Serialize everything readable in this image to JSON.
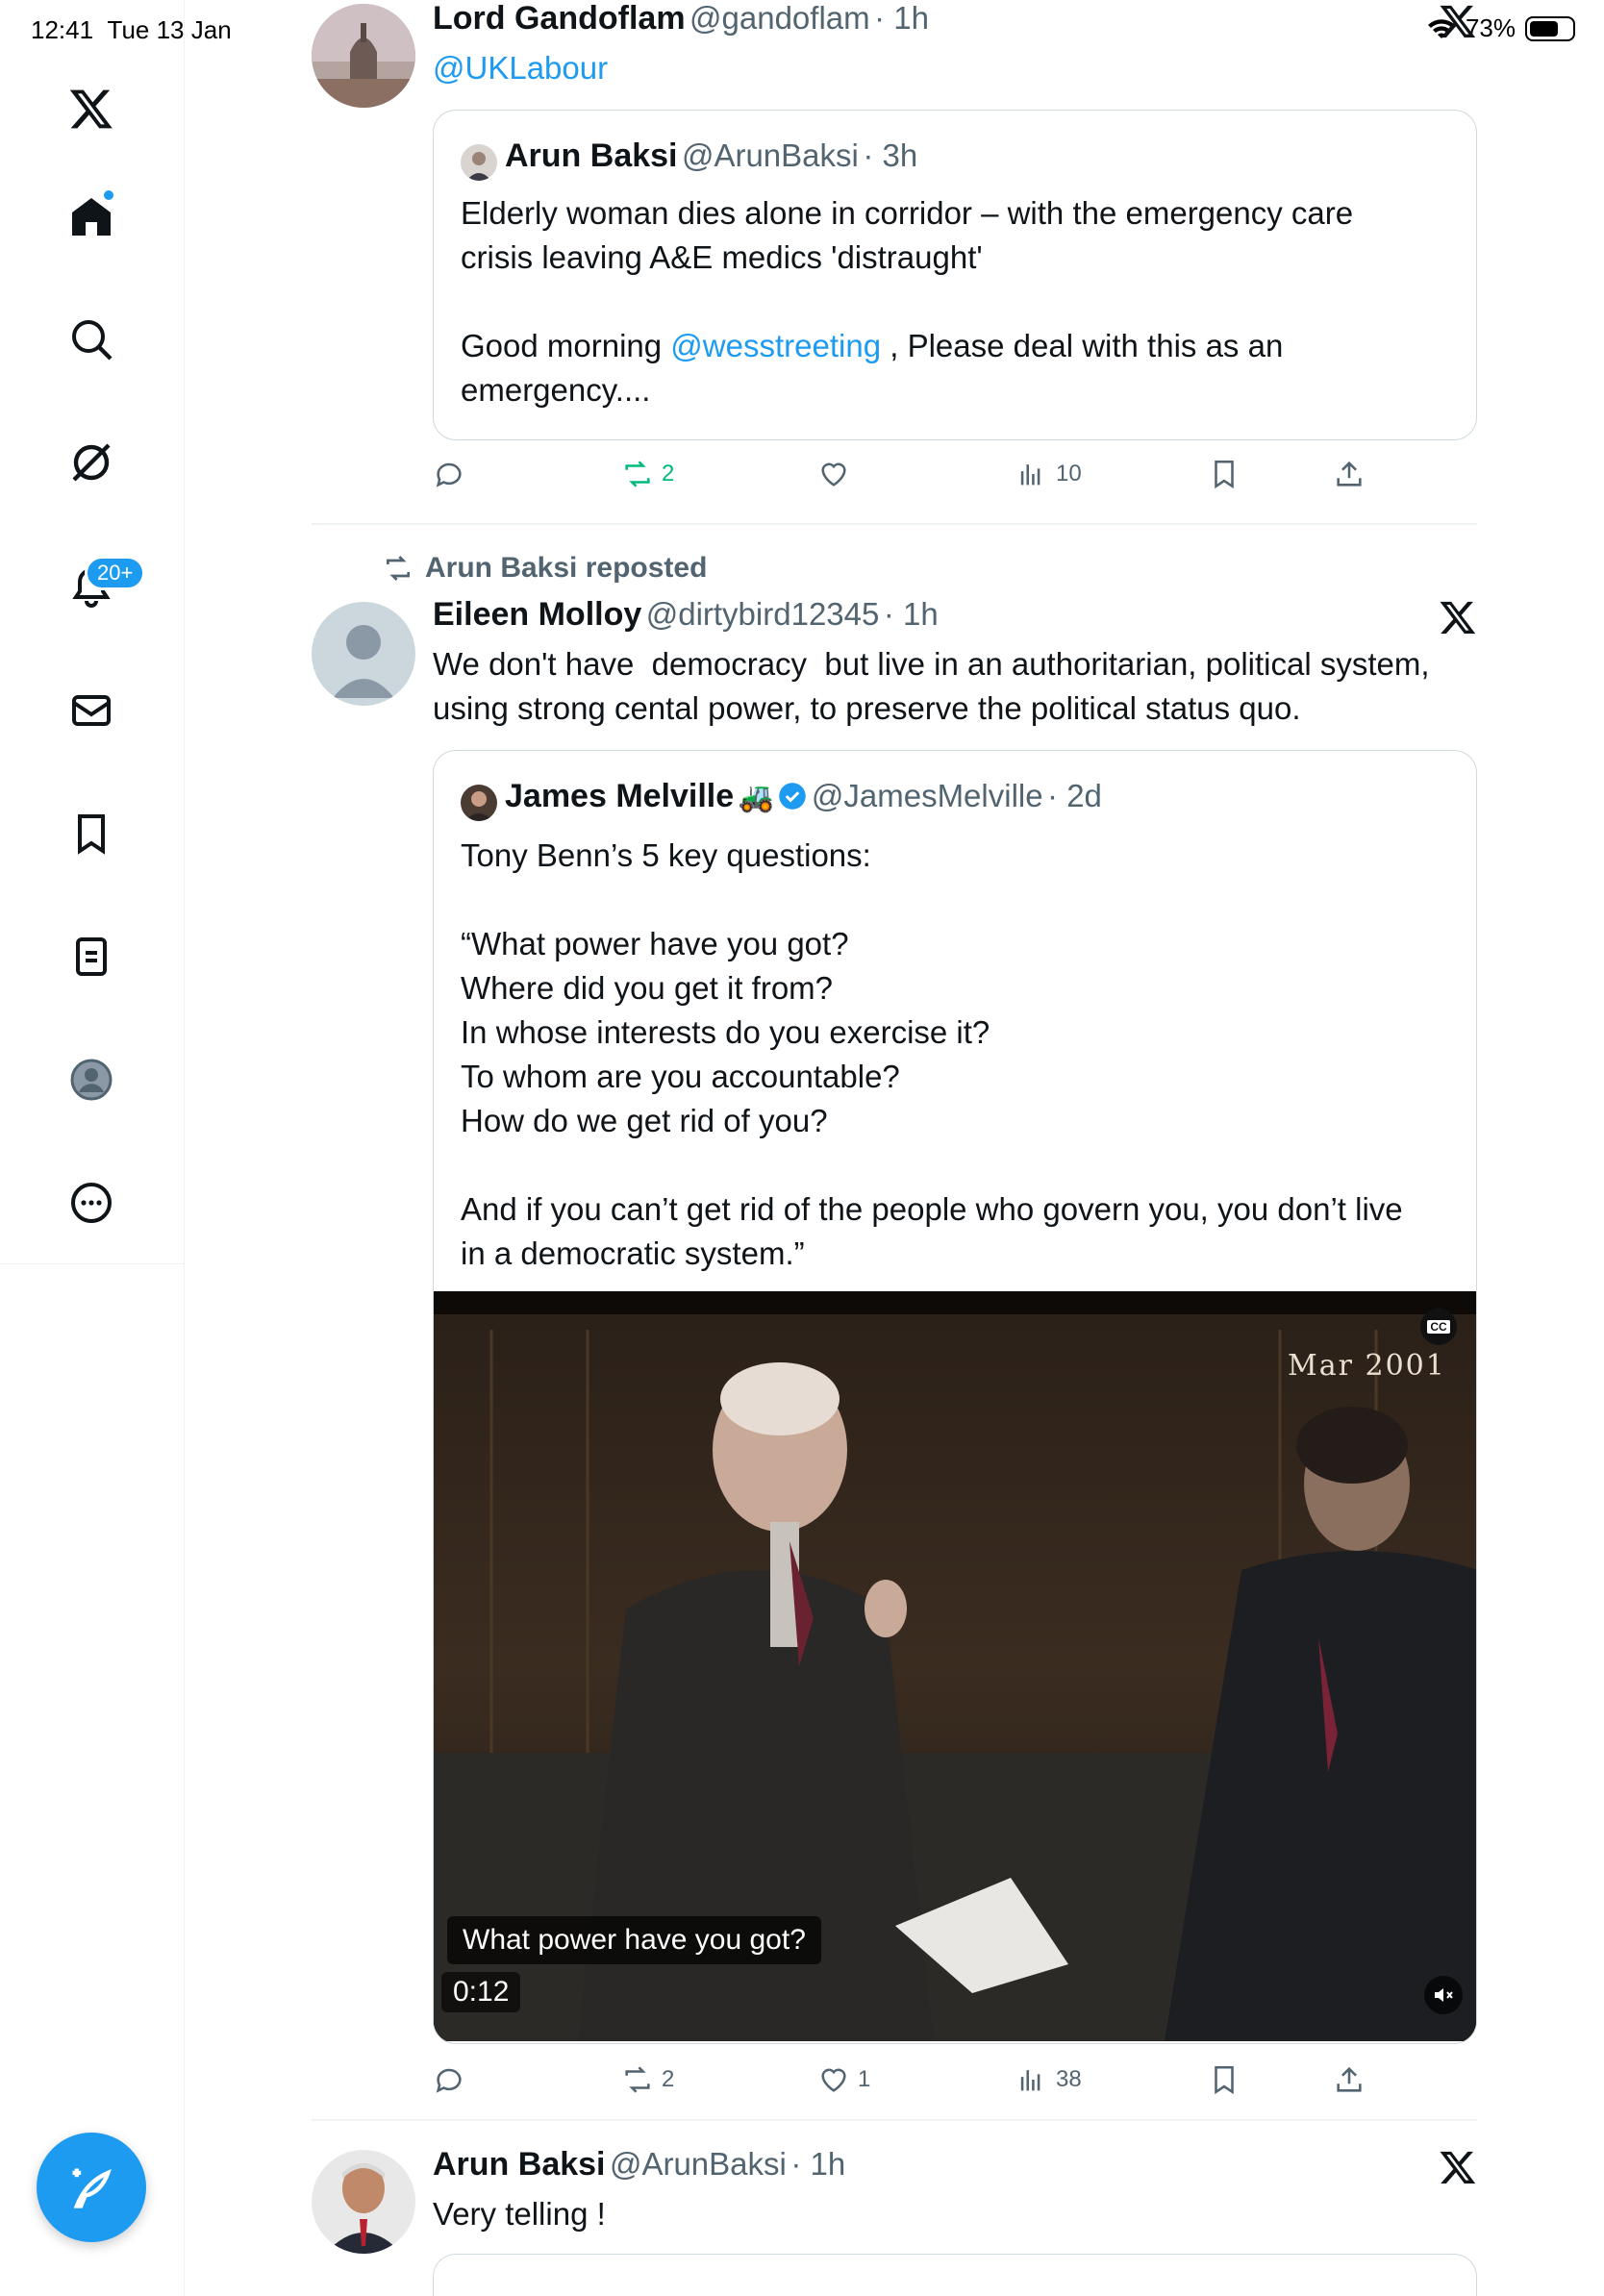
{
  "status_bar": {
    "time": "12:41",
    "date": "Tue 13 Jan",
    "battery": "73%"
  },
  "sidebar": {
    "notifications_badge": "20+",
    "icons": [
      "x-logo-icon",
      "home-icon",
      "search-icon",
      "grok-icon",
      "bell-icon",
      "mail-icon",
      "bookmark-icon",
      "lists-icon",
      "profile-icon",
      "more-icon"
    ]
  },
  "posts": [
    {
      "name": "Lord Gandoflam",
      "handle": "@gandoflam",
      "time": "· 1h",
      "reply_to": "@UKLabour",
      "quote": {
        "name": "Arun Baksi",
        "handle": "@ArunBaksi",
        "time": "· 3h",
        "line1": "Elderly woman dies alone in corridor – with the emergency care",
        "line2": "crisis leaving A&E medics 'distraught'",
        "line3_prefix": "Good morning ",
        "line3_mention": "@wesstreeting",
        "line3_suffix": " , Please deal with this as an",
        "line4": "emergency...."
      },
      "actions": {
        "reposts": "2",
        "views": "10"
      }
    },
    {
      "repost_label": "Arun Baksi reposted",
      "name": "Eileen Molloy",
      "handle": "@dirtybird12345",
      "time": "· 1h",
      "line1": "We don't have  democracy  but live in an authoritarian, political system,",
      "line2": "using strong cental power, to preserve the political status quo.",
      "quote": {
        "name": "James Melville",
        "emoji": "🚜",
        "handle": "@JamesMelville",
        "time": "· 2d",
        "lines": [
          "Tony Benn’s 5 key questions:",
          "",
          "“What power have you got?",
          "Where did you get it from?",
          "In whose interests do you exercise it?",
          "To whom are you accountable?",
          "How do we get rid of you?",
          "",
          "And if you can’t get rid of the people who govern you, you don’t live",
          "in a democratic system.”"
        ],
        "video": {
          "date_overlay": "Mar 2001",
          "caption": "What power have you got?",
          "timestamp": "0:12",
          "cc_label": "CC"
        }
      },
      "actions": {
        "reposts": "2",
        "likes": "1",
        "views": "38"
      }
    },
    {
      "name": "Arun Baksi",
      "handle": "@ArunBaksi",
      "time": "· 1h",
      "text": "Very telling !"
    }
  ],
  "colors": {
    "accent": "#1d9bf0",
    "repost_green": "#00ba7c",
    "secondary": "#536471"
  }
}
